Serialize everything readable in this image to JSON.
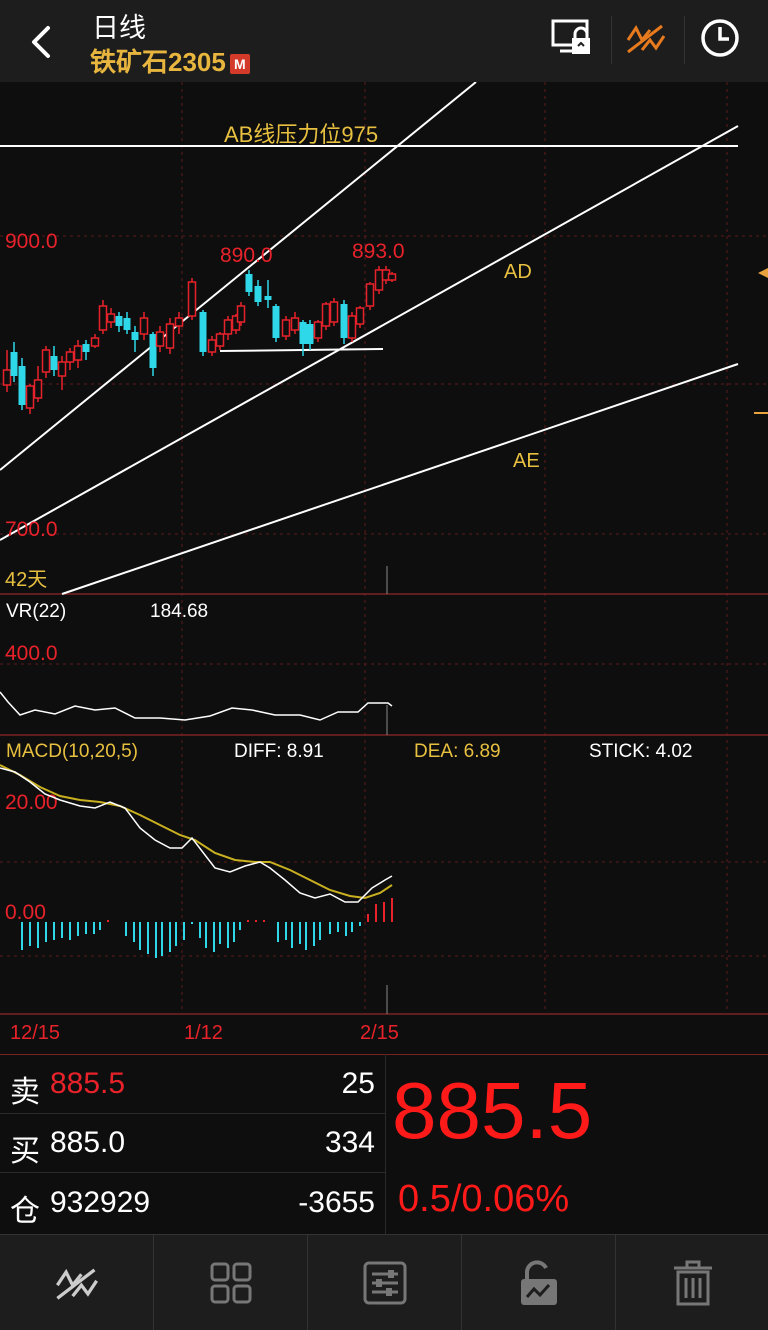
{
  "header": {
    "period": "日线",
    "symbol": "铁矿石2305",
    "badge": "M",
    "icons": [
      "back-icon",
      "screen-unlock-icon",
      "draw-line-icon",
      "clock-icon"
    ]
  },
  "main_chart": {
    "price_labels": {
      "top": "900.0",
      "bottom": "700.0"
    },
    "days_label": "42天",
    "annotations": {
      "pressure": "AB线压力位975",
      "high1": "890.0",
      "high2": "893.0",
      "line_ad": "AD",
      "line_ae": "AE"
    }
  },
  "vr": {
    "label": "VR(22)",
    "value": "184.68",
    "axis": "400.0"
  },
  "macd": {
    "label": "MACD(10,20,5)",
    "diff": "DIFF: 8.91",
    "dea": "DEA: 6.89",
    "stick": "STICK: 4.02",
    "axis_top": "20.00",
    "axis_zero": "0.00"
  },
  "dates": [
    "12/15",
    "1/12",
    "2/15"
  ],
  "quote": {
    "sell_label": "卖",
    "sell_price": "885.5",
    "sell_qty": "25",
    "buy_label": "买",
    "buy_price": "885.0",
    "buy_qty": "334",
    "oi_label": "仓",
    "oi_value": "932929",
    "oi_change": "-3655",
    "last_price": "885.5",
    "change": "0.5/0.06%"
  },
  "toolbar": [
    "draw-line-icon",
    "grid-icon",
    "settings-sliders-icon",
    "unlock-icon",
    "trash-icon"
  ],
  "colors": {
    "up": "#e8222a",
    "down": "#2fd8e8",
    "label_red": "#e8222a",
    "accent_yellow": "#e8c040",
    "background": "#0e0e0e"
  }
}
